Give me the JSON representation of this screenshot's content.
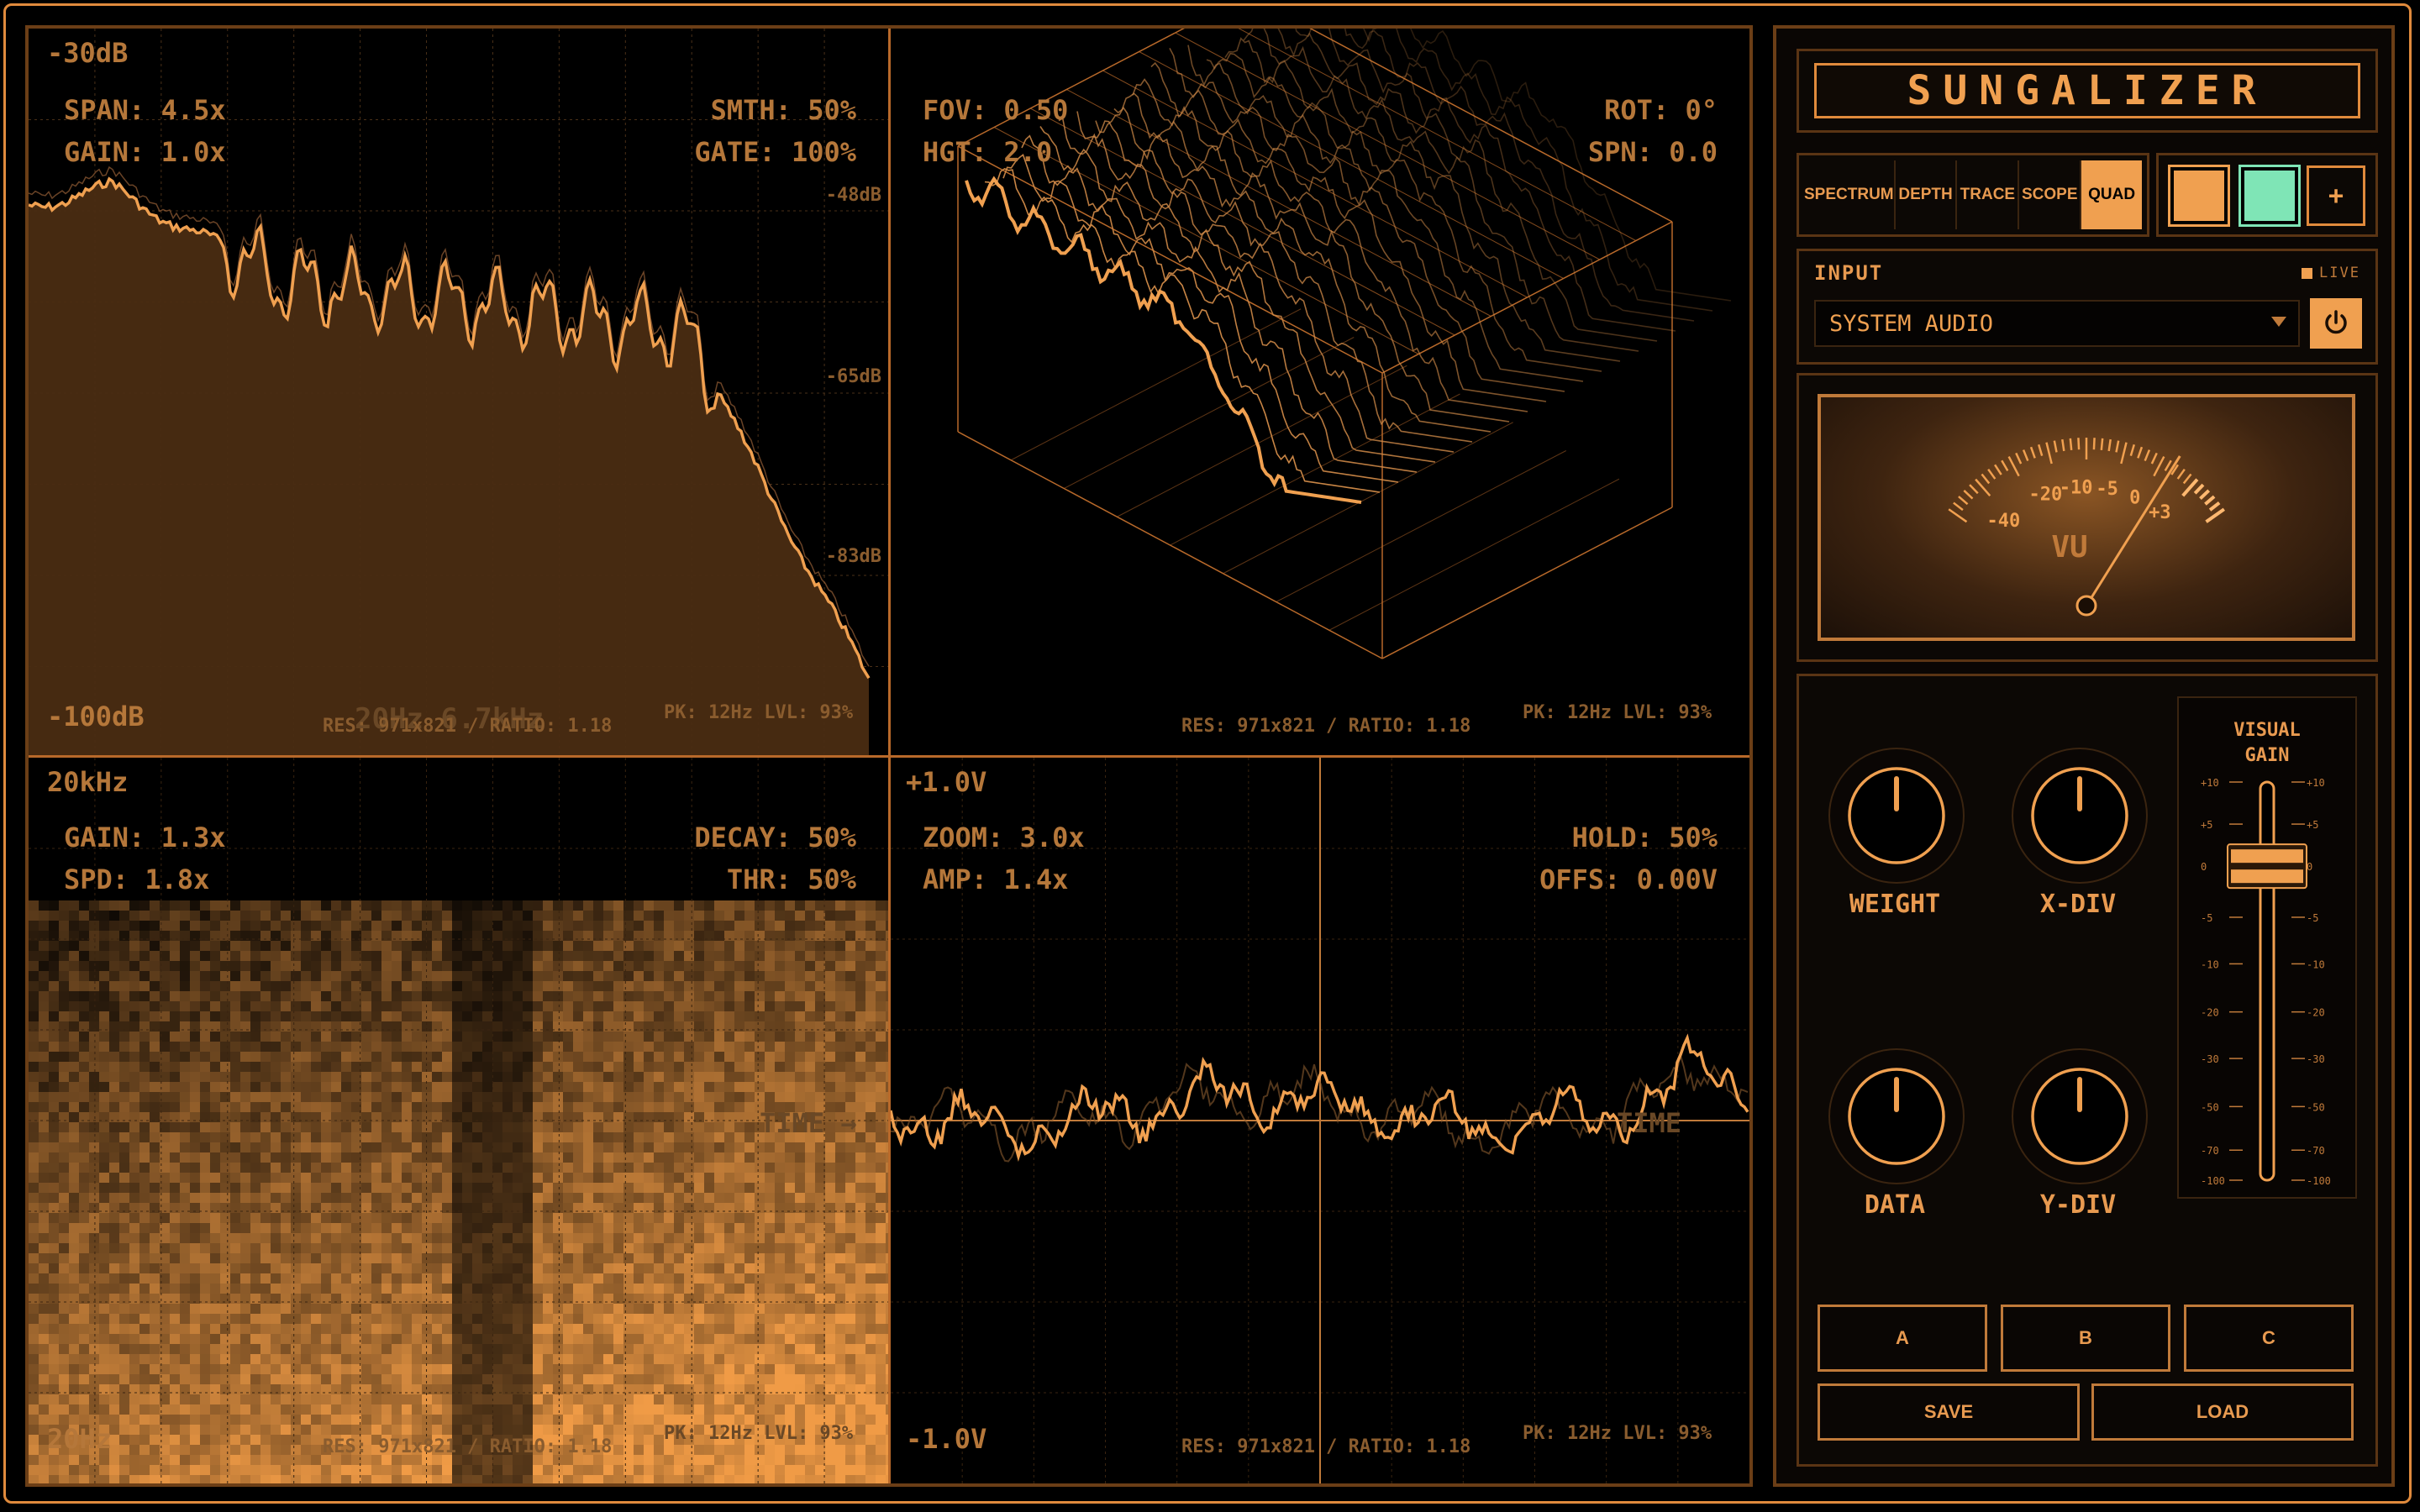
{
  "app": {
    "title": "SUNGALIZER"
  },
  "tabs": [
    {
      "label": "SPECTRUM",
      "active": false
    },
    {
      "label": "DEPTH",
      "active": false
    },
    {
      "label": "TRACE",
      "active": false
    },
    {
      "label": "SCOPE",
      "active": false
    },
    {
      "label": "QUAD",
      "active": true
    }
  ],
  "swatches": {
    "color1": "#f0a050",
    "color2": "#7fe5b6",
    "add_label": "+"
  },
  "input": {
    "label": "INPUT",
    "live_label": "LIVE",
    "source": "SYSTEM AUDIO"
  },
  "vu": {
    "label": "VU",
    "scale": [
      "-40",
      "-20",
      "-10",
      "-5",
      "0",
      "+3"
    ]
  },
  "knobs": [
    {
      "label": "WEIGHT"
    },
    {
      "label": "X-DIV"
    },
    {
      "label": "DATA"
    },
    {
      "label": "Y-DIV"
    }
  ],
  "fader": {
    "title_line1": "VISUAL",
    "title_line2": "GAIN",
    "scale": [
      "+10",
      "+5",
      "0",
      "-5",
      "-10",
      "-20",
      "-30",
      "-50",
      "-70",
      "-100"
    ]
  },
  "presets": [
    "A",
    "B",
    "C"
  ],
  "actions": {
    "save": "SAVE",
    "load": "LOAD"
  },
  "spectrum": {
    "top_left": "-30dB",
    "bottom_left": "-100dB",
    "span": "SPAN: 4.5x",
    "gain": "GAIN: 1.0x",
    "smth": "SMTH: 50%",
    "gate": "GATE: 100%",
    "db_marks": [
      "-48dB",
      "-65dB",
      "-83dB"
    ],
    "freq": "20Hz   6.7kHz",
    "res": "RES: 971x821 / RATIO: 1.18",
    "pk": "PK: 12Hz  LVL: 93%"
  },
  "depth": {
    "fov": "FOV: 0.50",
    "hgt": "HGT: 2.0",
    "rot": "ROT: 0°",
    "spn": "SPN: 0.0",
    "res": "RES: 971x821 / RATIO: 1.18",
    "pk": "PK: 12Hz  LVL: 93%"
  },
  "trace": {
    "top_left": "20kHz",
    "bottom_left": "20Hz",
    "gain": "GAIN: 1.3x",
    "spd": "SPD: 1.8x",
    "decay": "DECAY: 50%",
    "thr": "THR: 50%",
    "time": "TIME →",
    "res": "RES: 971x821 / RATIO: 1.18",
    "pk": "PK: 12Hz  LVL: 93%"
  },
  "scope": {
    "top_left": "+1.0V",
    "bottom_left": "-1.0V",
    "zoom": "ZOOM: 3.0x",
    "amp": "AMP: 1.4x",
    "hold": "HOLD: 50%",
    "offs": "OFFS: 0.00V",
    "time": "TIME",
    "res": "RES: 971x821 / RATIO: 1.18",
    "pk": "PK: 12Hz  LVL: 93%"
  }
}
